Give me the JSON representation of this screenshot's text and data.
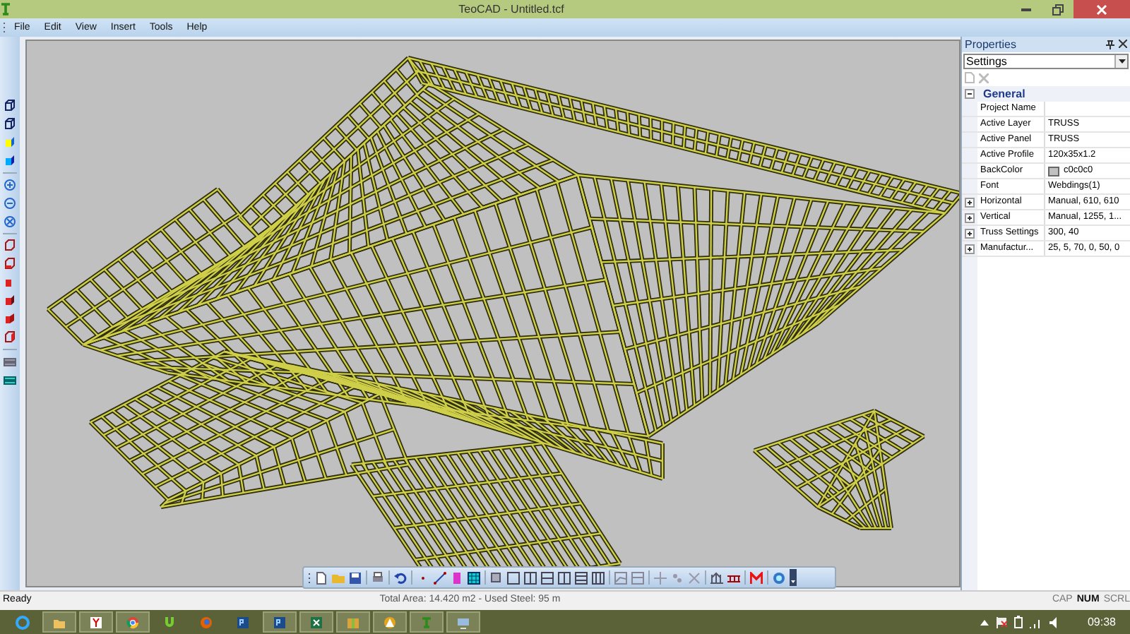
{
  "window": {
    "title": "TeoCAD - Untitled.tcf"
  },
  "menu": [
    "File",
    "Edit",
    "View",
    "Insert",
    "Tools",
    "Help"
  ],
  "properties": {
    "title": "Properties",
    "selector": "Settings",
    "group": {
      "label": "General",
      "expanded": true
    },
    "rows": [
      {
        "label": "Project Name",
        "value": "",
        "kind": "text"
      },
      {
        "label": "Active Layer",
        "value": "TRUSS",
        "kind": "text"
      },
      {
        "label": "Active Panel",
        "value": "TRUSS",
        "kind": "text"
      },
      {
        "label": "Active Profile",
        "value": "120x35x1.2",
        "kind": "text"
      },
      {
        "label": "BackColor",
        "value": "c0c0c0",
        "kind": "color",
        "color": "#c0c0c0"
      },
      {
        "label": "Font",
        "value": "Webdings(1)",
        "kind": "text"
      },
      {
        "label": "Horizontal",
        "value": "Manual, 610, 610",
        "kind": "expandable",
        "expanded": false
      },
      {
        "label": "Vertical",
        "value": "Manual, 1255, 1...",
        "kind": "expandable",
        "expanded": false
      },
      {
        "label": "Truss Settings",
        "value": "300, 40",
        "kind": "expandable",
        "expanded": false
      },
      {
        "label": "Manufactur...",
        "value": "25, 5, 70, 0, 50, 0",
        "kind": "expandable",
        "expanded": false
      }
    ]
  },
  "status_bar": {
    "left": "Ready",
    "center": "Total Area: 14.420 m2  - Used Steel: 95 m",
    "indicators": [
      {
        "label": "CAP",
        "on": false
      },
      {
        "label": "NUM",
        "on": true
      },
      {
        "label": "SCRL",
        "on": false
      }
    ]
  },
  "taskbar": {
    "apps": [
      {
        "kind": "ie",
        "selected": false
      },
      {
        "kind": "folder",
        "selected": true
      },
      {
        "kind": "yandex",
        "selected": true
      },
      {
        "kind": "chrome",
        "selected": true
      },
      {
        "kind": "torrent",
        "selected": false
      },
      {
        "kind": "firefox",
        "selected": false
      },
      {
        "kind": "ps",
        "selected": false
      },
      {
        "kind": "ps",
        "selected": true
      },
      {
        "kind": "excel",
        "selected": true
      },
      {
        "kind": "archive",
        "selected": true
      },
      {
        "kind": "autocad",
        "selected": true
      },
      {
        "kind": "teocad",
        "selected": true
      },
      {
        "kind": "remote",
        "selected": true
      }
    ],
    "clock": "09:38"
  }
}
